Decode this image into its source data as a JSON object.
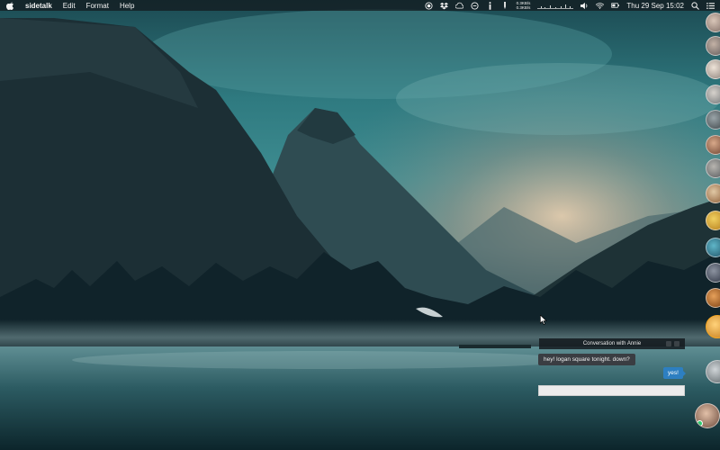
{
  "menubar": {
    "app_name": "sidetalk",
    "menus": [
      "Edit",
      "Format",
      "Help"
    ],
    "net_up": "0.3KB/s",
    "net_down": "0.3KB/s",
    "datetime": "Thu 29 Sep 15:02",
    "tray_icons": [
      "record-icon",
      "dropbox-icon",
      "creative-cloud-icon",
      "sync-icon",
      "info-icon",
      "pen-icon",
      "speaker-icon",
      "wifi-icon",
      "battery-icon",
      "spotlight-icon",
      "notification-center-icon"
    ]
  },
  "chat": {
    "title": "Conversation with Annie",
    "incoming_message": "hey! logan square tonight. down?",
    "outgoing_message": "yes!",
    "input_value": "",
    "input_placeholder": ""
  },
  "sidebar": {
    "contact_count": 17,
    "online_indicator_color": "#2ecc71"
  },
  "colors": {
    "menubar_bg": "#12181c",
    "bubble_out": "#2d7fc1",
    "bubble_in": "#3a3d42"
  }
}
